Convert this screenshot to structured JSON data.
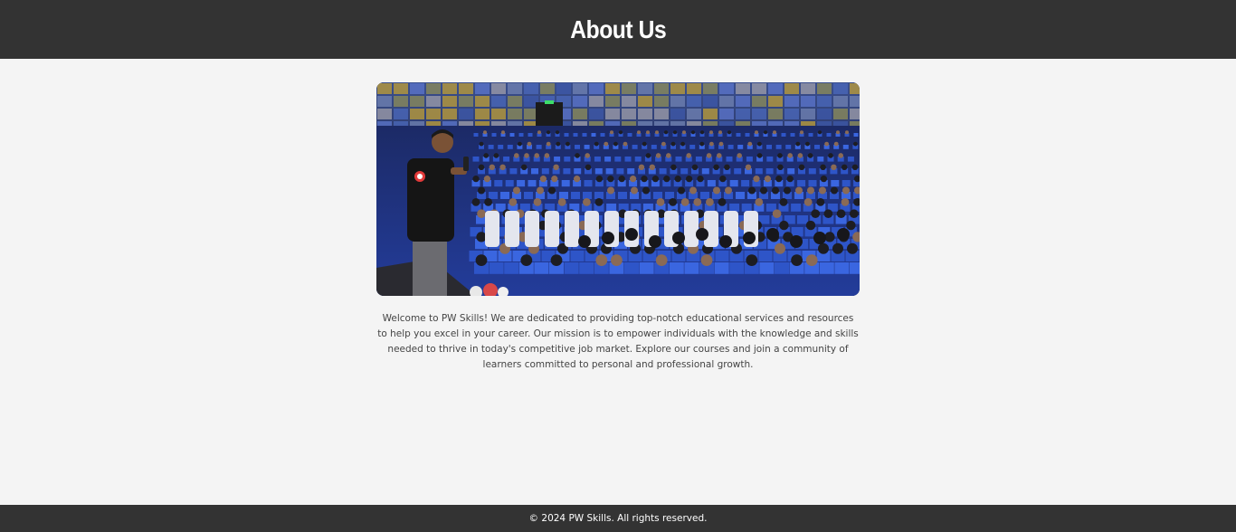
{
  "header": {
    "title": "About Us"
  },
  "main": {
    "image": {
      "alt": "Speaker addressing an audience in an auditorium"
    },
    "description": "Welcome to PW Skills! We are dedicated to providing top-notch educational services and resources to help you excel in your career. Our mission is to empower individuals with the knowledge and skills needed to thrive in today's competitive job market. Explore our courses and join a community of learners committed to personal and professional growth."
  },
  "footer": {
    "copyright": "© 2024 PW Skills. All rights reserved."
  },
  "colors": {
    "header_bg": "#333333",
    "page_bg": "#f4f4f4",
    "text": "#444444",
    "seat_blue": "#2e55c8"
  }
}
